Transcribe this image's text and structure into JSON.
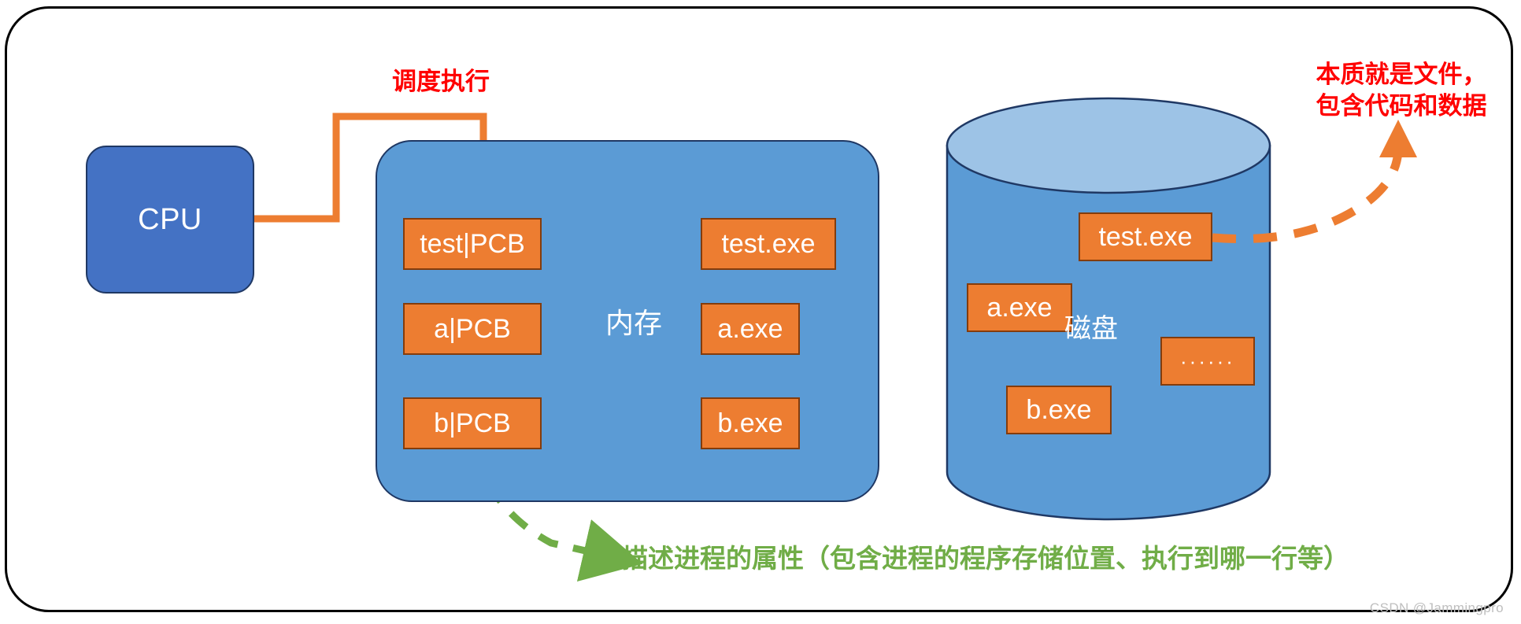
{
  "diagram": {
    "title_notes": {
      "schedule_note": "调度执行",
      "file_note": "本质就是文件，\n包含代码和数据",
      "pcb_note": "描述进程的属性（包含进程的程序存储位置、执行到哪一行等）"
    },
    "cpu": {
      "label": "CPU"
    },
    "memory": {
      "label": "内存",
      "pcb_boxes": [
        {
          "label": "test|PCB"
        },
        {
          "label": "a|PCB"
        },
        {
          "label": "b|PCB"
        }
      ],
      "exe_boxes": [
        {
          "label": "test.exe"
        },
        {
          "label": "a.exe"
        },
        {
          "label": "b.exe"
        }
      ]
    },
    "disk": {
      "label": "磁盘",
      "files": [
        {
          "label": "test.exe"
        },
        {
          "label": "a.exe"
        },
        {
          "label": "b.exe"
        },
        {
          "label": "······"
        }
      ]
    },
    "watermark": "CSDN @Jammingpro",
    "colors": {
      "orange_fill": "#ED7D31",
      "orange_stroke": "#843C0C",
      "blue_panel": "#5B9BD5",
      "blue_cpu": "#4472C4",
      "navy_stroke": "#1F3864",
      "cylinder_top": "#9DC3E6",
      "yellow_arrow": "#FFC000",
      "yellow_arrow_stroke": "#7F6000",
      "red_text": "#FF0000",
      "green_text": "#70AD47",
      "frame_stroke": "#000000"
    }
  }
}
